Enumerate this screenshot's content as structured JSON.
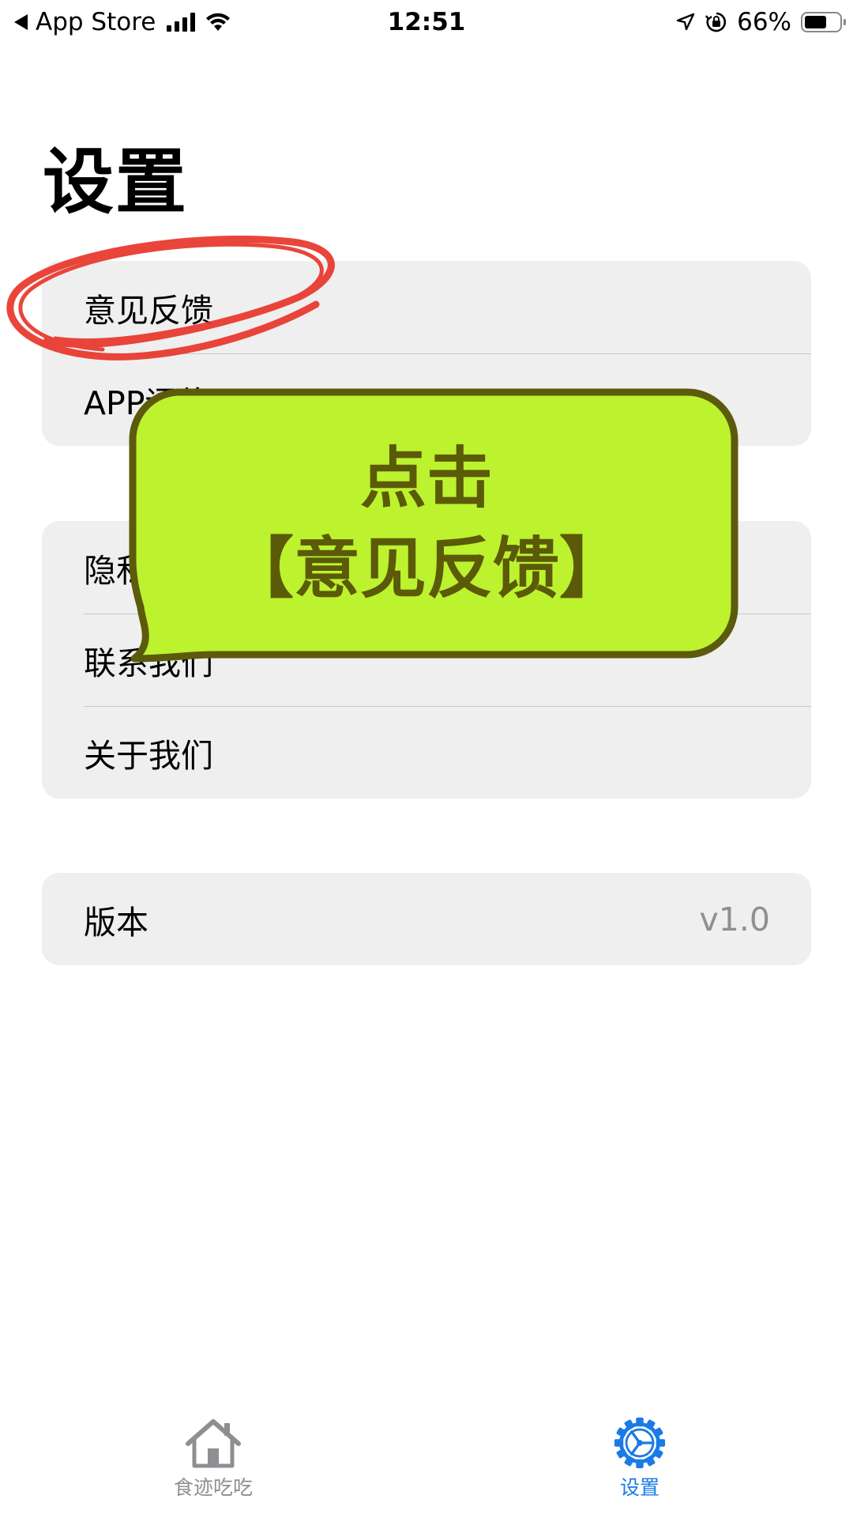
{
  "status_bar": {
    "back_label": "App Store",
    "time": "12:51",
    "battery_percent": "66%",
    "battery_level": 0.66
  },
  "page": {
    "title": "设置"
  },
  "groups": [
    {
      "rows": [
        {
          "label": "意见反馈"
        },
        {
          "label": "APP评价"
        }
      ]
    },
    {
      "rows": [
        {
          "label": "隐私政策"
        },
        {
          "label": "联系我们"
        },
        {
          "label": "关于我们"
        }
      ]
    },
    {
      "rows": [
        {
          "label": "版本",
          "value": "v1.0"
        }
      ]
    }
  ],
  "annotation": {
    "line1": "点击",
    "line2": "【意见反馈】",
    "bubble_color": "#bdf22f",
    "bubble_border": "#5c5a0c",
    "circle_color": "#e8362b"
  },
  "tab_bar": {
    "tabs": [
      {
        "label": "食迹吃吃",
        "icon": "house-icon",
        "active": false
      },
      {
        "label": "设置",
        "icon": "gear-icon",
        "active": true
      }
    ],
    "active_color": "#1a7ae8",
    "inactive_color": "#8e8e93"
  }
}
